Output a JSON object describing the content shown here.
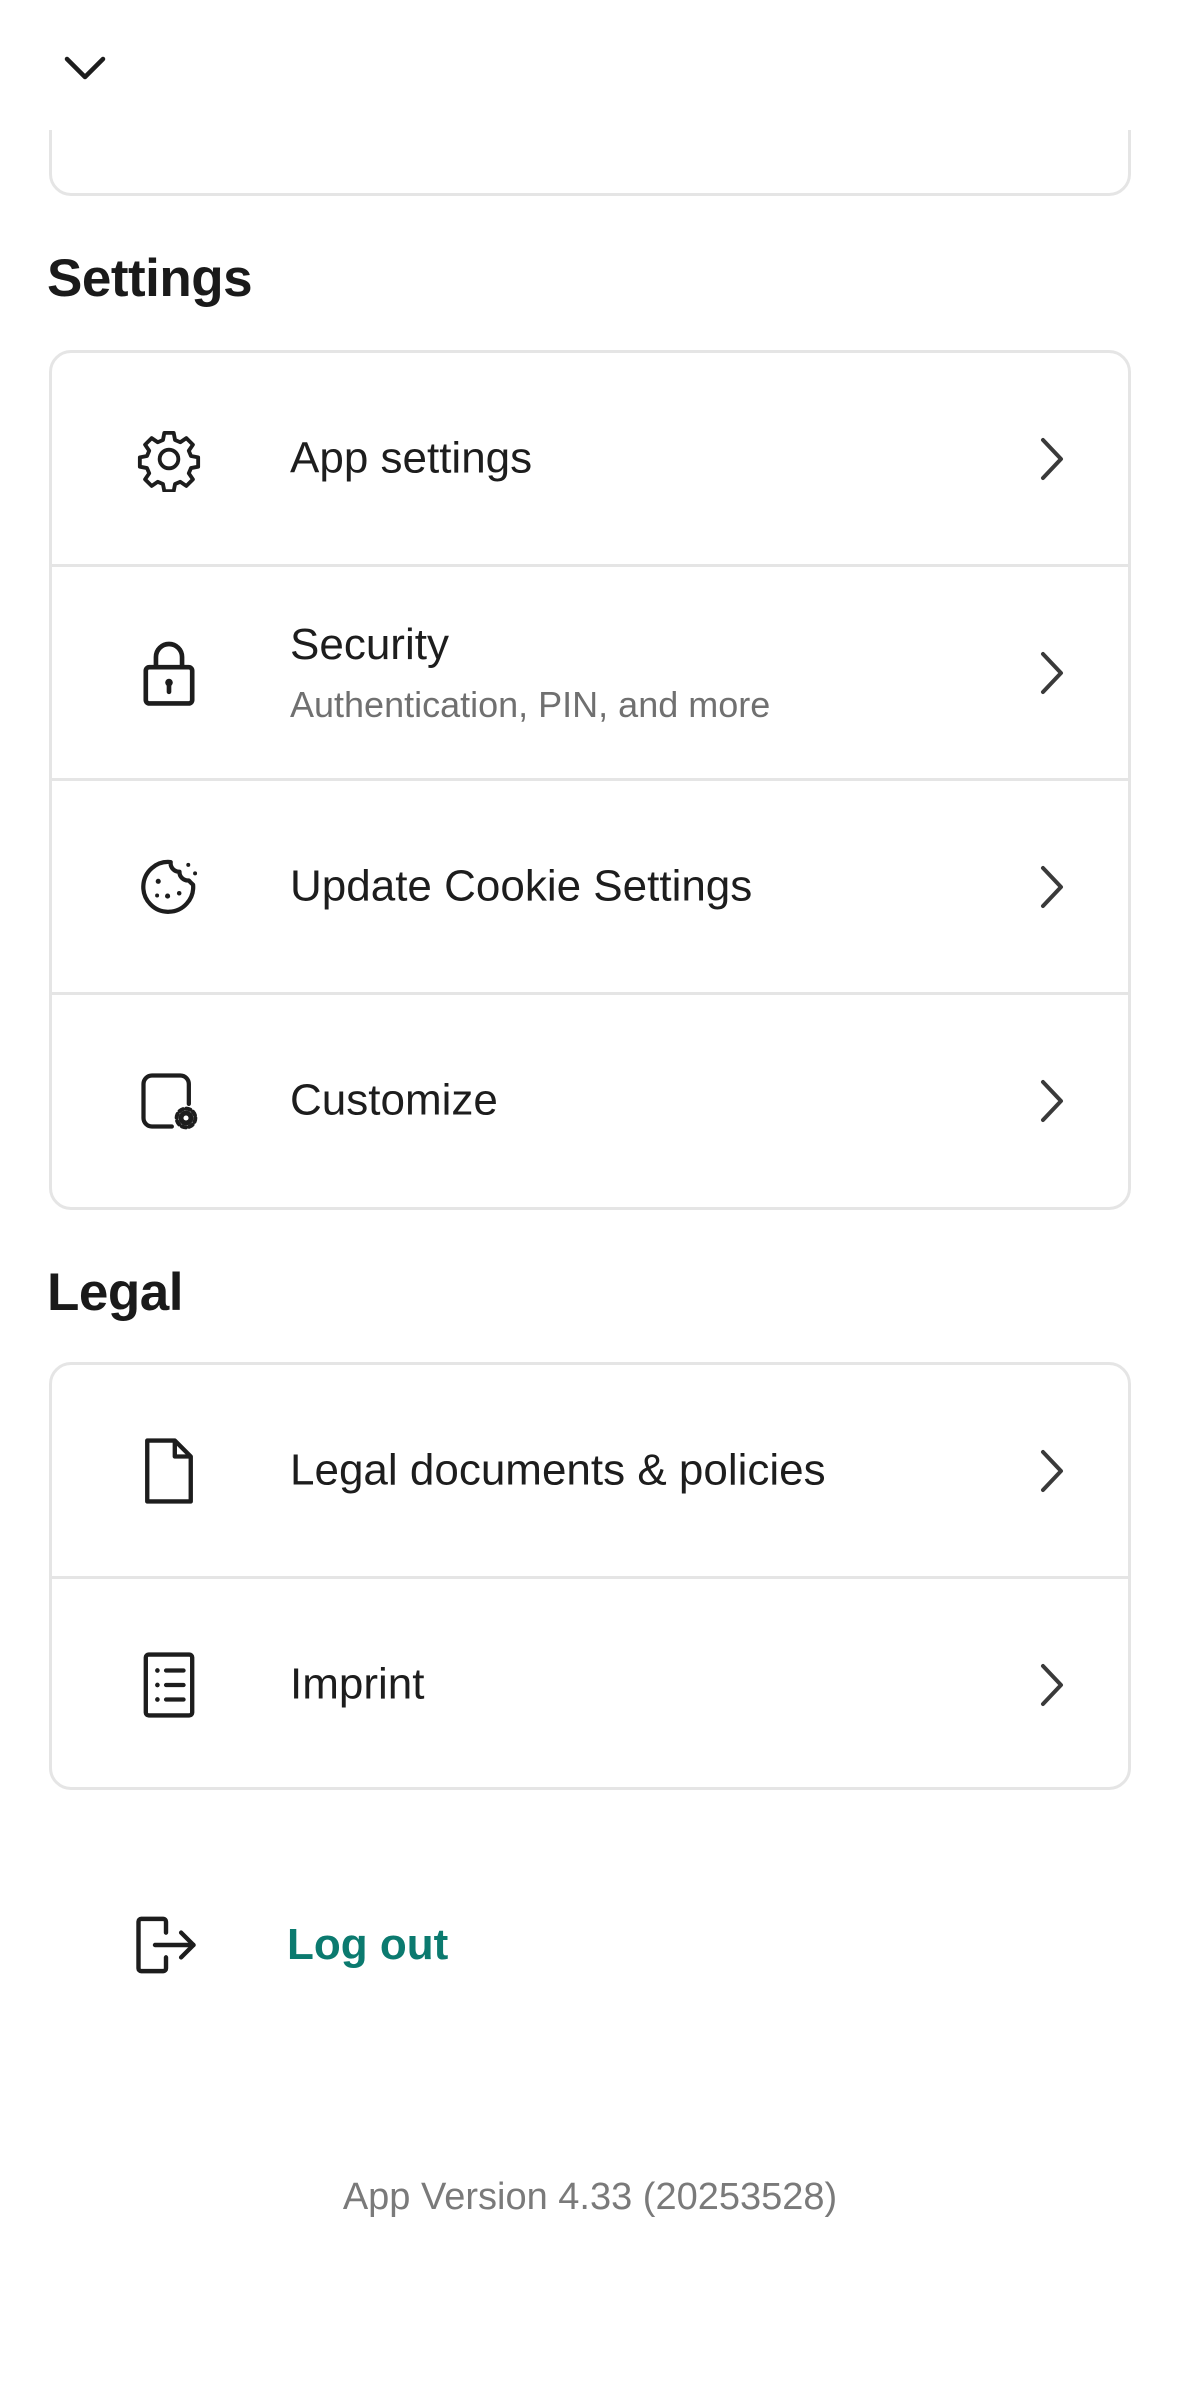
{
  "header": {
    "collapse_icon": "chevron-down-icon"
  },
  "settings": {
    "title": "Settings",
    "items": [
      {
        "label": "App settings",
        "sublabel": "",
        "icon": "gear-icon"
      },
      {
        "label": "Security",
        "sublabel": "Authentication, PIN, and more",
        "icon": "lock-icon"
      },
      {
        "label": "Update Cookie Settings",
        "sublabel": "",
        "icon": "cookie-icon"
      },
      {
        "label": "Customize",
        "sublabel": "",
        "icon": "customize-icon"
      }
    ]
  },
  "legal": {
    "title": "Legal",
    "items": [
      {
        "label": "Legal documents & policies",
        "icon": "document-icon"
      },
      {
        "label": "Imprint",
        "icon": "list-document-icon"
      }
    ]
  },
  "logout": {
    "label": "Log out",
    "icon": "logout-icon",
    "color": "#0b7a6f"
  },
  "footer": {
    "version": "App Version 4.33 (20253528)"
  }
}
